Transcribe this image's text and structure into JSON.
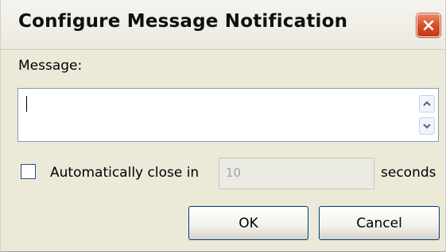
{
  "window": {
    "title": "Configure Message Notification"
  },
  "message": {
    "label": "Message:",
    "value": ""
  },
  "auto_close": {
    "label": "Automatically close in",
    "checked": false,
    "seconds_value": "10",
    "seconds_label": "seconds"
  },
  "buttons": {
    "ok": "OK",
    "cancel": "Cancel"
  }
}
